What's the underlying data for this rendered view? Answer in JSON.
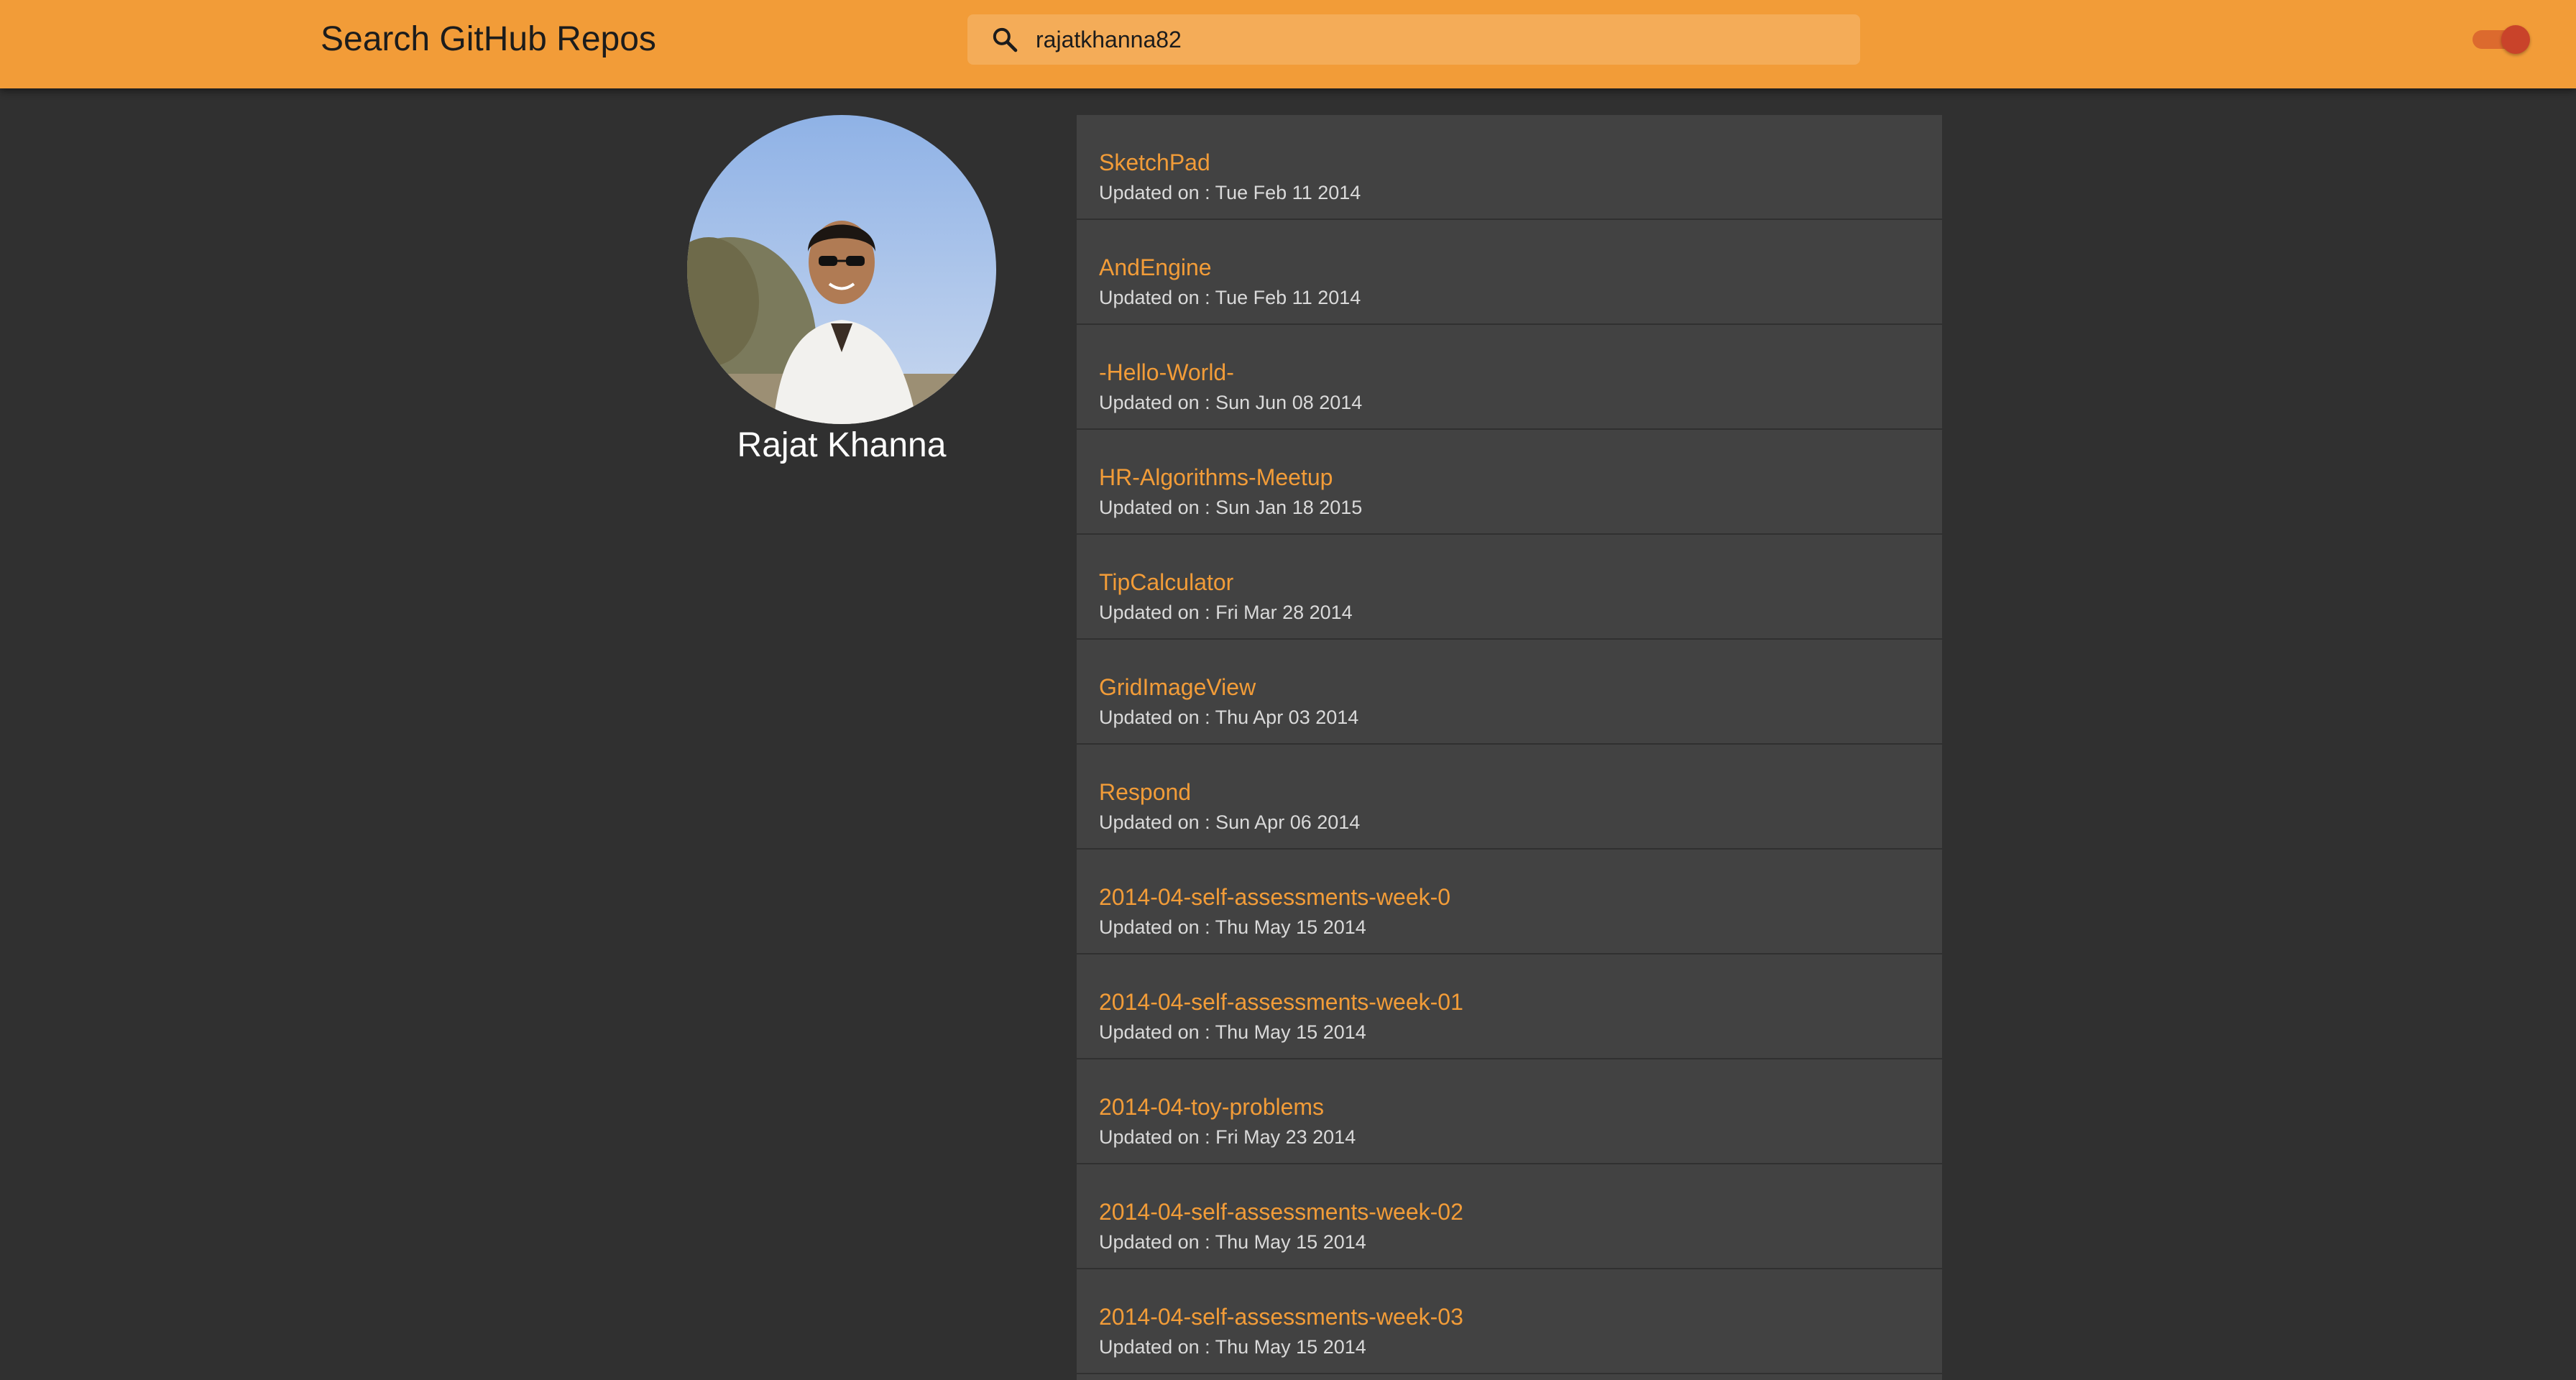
{
  "app_bar": {
    "title": "Search GitHub Repos",
    "search": {
      "value": "rajatkhanna82",
      "icon": "search-icon"
    },
    "theme_toggle": {
      "on": true
    }
  },
  "profile": {
    "name": "Rajat Khanna",
    "avatar_icon": "avatar"
  },
  "repos": [
    {
      "name": "SketchPad",
      "updated": "Updated on : Tue Feb 11 2014"
    },
    {
      "name": "AndEngine",
      "updated": "Updated on : Tue Feb 11 2014"
    },
    {
      "name": "-Hello-World-",
      "updated": "Updated on : Sun Jun 08 2014"
    },
    {
      "name": "HR-Algorithms-Meetup",
      "updated": "Updated on : Sun Jan 18 2015"
    },
    {
      "name": "TipCalculator",
      "updated": "Updated on : Fri Mar 28 2014"
    },
    {
      "name": "GridImageView",
      "updated": "Updated on : Thu Apr 03 2014"
    },
    {
      "name": "Respond",
      "updated": "Updated on : Sun Apr 06 2014"
    },
    {
      "name": "2014-04-self-assessments-week-0",
      "updated": "Updated on : Thu May 15 2014"
    },
    {
      "name": "2014-04-self-assessments-week-01",
      "updated": "Updated on : Thu May 15 2014"
    },
    {
      "name": "2014-04-toy-problems",
      "updated": "Updated on : Fri May 23 2014"
    },
    {
      "name": "2014-04-self-assessments-week-02",
      "updated": "Updated on : Thu May 15 2014"
    },
    {
      "name": "2014-04-self-assessments-week-03",
      "updated": "Updated on : Thu May 15 2014"
    }
  ],
  "colors": {
    "accent": "#f29c38",
    "background": "#303030",
    "card": "#424242"
  }
}
